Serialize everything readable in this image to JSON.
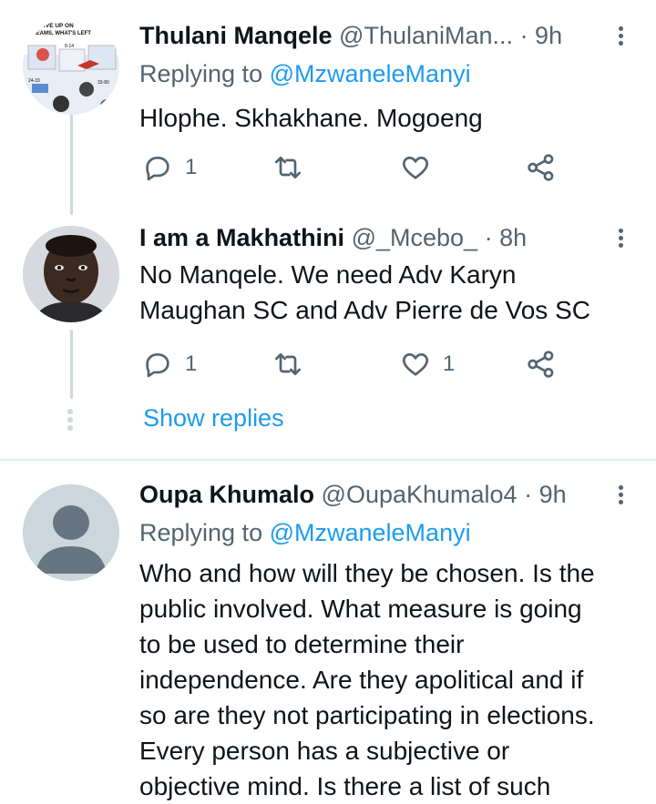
{
  "tweets": [
    {
      "name": "Thulani Manqele",
      "handle": "@ThulaniMan...",
      "time": "· 9h",
      "replying_prefix": "Replying to ",
      "replying_to": "@MzwaneleManyi",
      "text": "Hlophe. Skhakhane. Mogoeng",
      "reply_count": "1",
      "retweet_count": "",
      "like_count": ""
    },
    {
      "name": "I am a Makhathini",
      "handle": "@_Mcebo_",
      "time": "· 8h",
      "text_lines": [
        "No Manqele. We need Adv Karyn",
        "Maughan SC and Adv Pierre de Vos SC"
      ],
      "reply_count": "1",
      "retweet_count": "",
      "like_count": "1"
    },
    {
      "name": "Oupa Khumalo",
      "handle": "@OupaKhumalo4",
      "time": "· 9h",
      "replying_prefix": "Replying to ",
      "replying_to": "@MzwaneleManyi",
      "text_lines": [
        "Who and how will they be chosen. Is the",
        "public involved. What measure is going",
        "to be used to determine their",
        "independence. Are they apolitical and if",
        "so are they not participating in elections.",
        "Every person has a subjective or",
        "objective mind. Is there a list of such"
      ]
    }
  ],
  "show_replies": "Show replies",
  "avatar_art_text": {
    "headline_1": "GIVE UP ON",
    "headline_2": "DREAMS, WHAT'S LEFT",
    "age_1": "8-14",
    "age_2": "24-33",
    "age_3": "33-80"
  },
  "colors": {
    "link_blue": "#1d9bf0",
    "secondary_text": "#536471",
    "thread_line": "#cfd9de",
    "divider": "#e6ecf0"
  },
  "icons": [
    "reply-icon",
    "retweet-icon",
    "like-icon",
    "share-icon",
    "more-options-icon"
  ]
}
